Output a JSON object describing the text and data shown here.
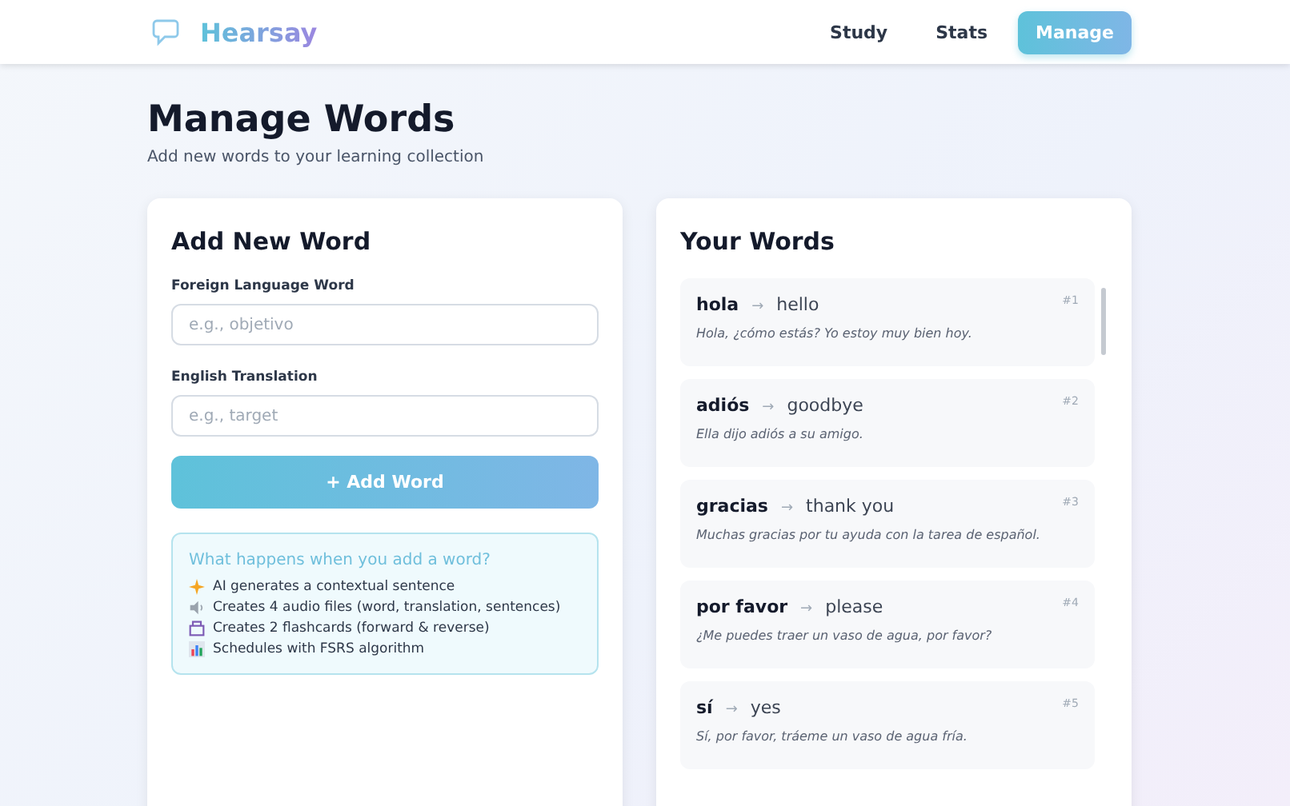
{
  "brand": {
    "name": "Hearsay"
  },
  "nav": [
    {
      "label": "Study",
      "selected": false
    },
    {
      "label": "Stats",
      "selected": false
    },
    {
      "label": "Manage",
      "selected": true
    }
  ],
  "page": {
    "title": "Manage Words",
    "subtitle": "Add new words to your learning collection"
  },
  "add_form": {
    "title": "Add New Word",
    "fields": [
      {
        "label": "Foreign Language Word",
        "placeholder": "e.g., objetivo"
      },
      {
        "label": "English Translation",
        "placeholder": "e.g., target"
      }
    ],
    "submit": "+ Add Word",
    "info": {
      "title": "What happens when you add a word?",
      "items": [
        {
          "kind": "sparkle",
          "text": "AI generates a contextual sentence"
        },
        {
          "kind": "speaker",
          "text": "Creates 4 audio files (word, translation, sentences)"
        },
        {
          "kind": "box",
          "text": "Creates 2 flashcards (forward & reverse)"
        },
        {
          "kind": "chart",
          "text": "Schedules with FSRS algorithm"
        }
      ]
    }
  },
  "word_list": {
    "title": "Your Words",
    "words": [
      {
        "word": "hola",
        "arrow": "→",
        "translation": "hello",
        "number": "#1",
        "sentence": "Hola, ¿cómo estás? Yo estoy muy bien hoy."
      },
      {
        "word": "adiós",
        "arrow": "→",
        "translation": "goodbye",
        "number": "#2",
        "sentence": "Ella dijo adiós a su amigo."
      },
      {
        "word": "gracias",
        "arrow": "→",
        "translation": "thank you",
        "number": "#3",
        "sentence": "Muchas gracias por tu ayuda con la tarea de español."
      },
      {
        "word": "por favor",
        "arrow": "→",
        "translation": "please",
        "number": "#4",
        "sentence": "¿Me puedes traer un vaso de agua, por favor?"
      },
      {
        "word": "sí",
        "arrow": "→",
        "translation": "yes",
        "number": "#5",
        "sentence": "Sí, por favor, tráeme un vaso de agua fría."
      }
    ]
  }
}
